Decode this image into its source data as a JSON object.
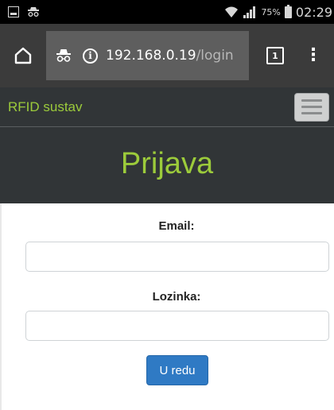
{
  "status_bar": {
    "battery_percent": "75%",
    "time": "02:29",
    "icons": [
      "image-notification-icon",
      "incognito-icon",
      "wifi-icon",
      "signal-icon",
      "battery-icon"
    ]
  },
  "browser": {
    "url_host": "192.168.0.19",
    "url_path": "/login",
    "tab_count": "1",
    "icons": [
      "home-icon",
      "incognito-icon",
      "info-icon",
      "tabs-icon",
      "overflow-menu-icon"
    ]
  },
  "app": {
    "brand": "RFID sustav",
    "brand_color": "#9ccb3b",
    "nav_bg": "#313537"
  },
  "page": {
    "title": "Prijava"
  },
  "form": {
    "email_label": "Email:",
    "email_value": "",
    "password_label": "Lozinka:",
    "password_value": "",
    "submit_label": "U redu",
    "submit_color": "#2f7ac4"
  }
}
